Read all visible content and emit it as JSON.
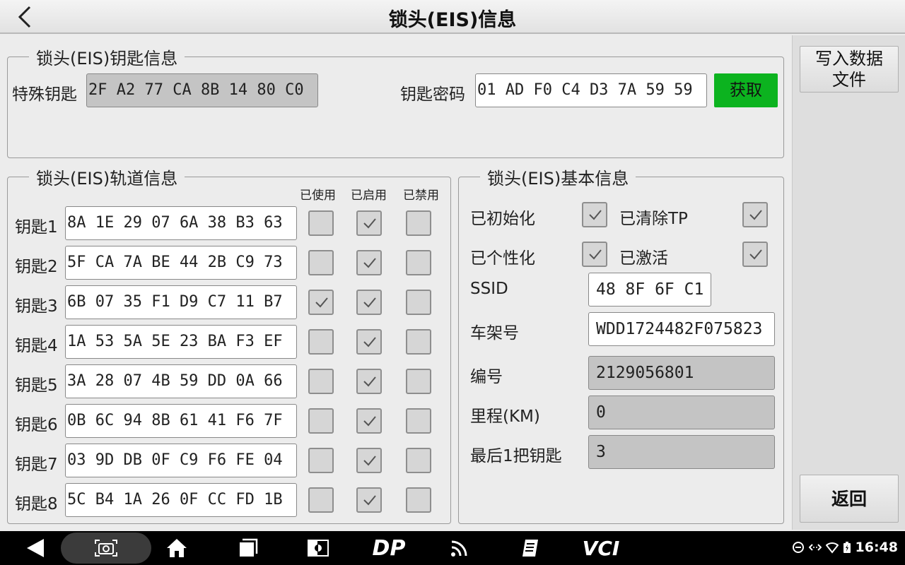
{
  "header": {
    "title": "锁头(EIS)信息"
  },
  "key_info": {
    "title": "锁头(EIS)钥匙信息",
    "special_key_label": "特殊钥匙",
    "special_key_value": "2F A2 77 CA 8B 14 80 C0",
    "key_password_label": "钥匙密码",
    "key_password_value": "01 AD F0 C4 D3 7A 59 59",
    "get_button": "获取"
  },
  "track_info": {
    "title": "锁头(EIS)轨道信息",
    "columns": [
      "已使用",
      "已启用",
      "已禁用"
    ],
    "keys": [
      {
        "label": "钥匙1",
        "value": "8A 1E 29 07 6A 38 B3 63",
        "used": false,
        "enabled": true,
        "disabled": false
      },
      {
        "label": "钥匙2",
        "value": "5F CA 7A BE 44 2B C9 73",
        "used": false,
        "enabled": true,
        "disabled": false
      },
      {
        "label": "钥匙3",
        "value": "6B 07 35 F1 D9 C7 11 B7",
        "used": true,
        "enabled": true,
        "disabled": false
      },
      {
        "label": "钥匙4",
        "value": "1A 53 5A 5E 23 BA F3 EF",
        "used": false,
        "enabled": true,
        "disabled": false
      },
      {
        "label": "钥匙5",
        "value": "3A 28 07 4B 59 DD 0A 66",
        "used": false,
        "enabled": true,
        "disabled": false
      },
      {
        "label": "钥匙6",
        "value": "0B 6C 94 8B 61 41 F6 7F",
        "used": false,
        "enabled": true,
        "disabled": false
      },
      {
        "label": "钥匙7",
        "value": "03 9D DB 0F C9 F6 FE 04",
        "used": false,
        "enabled": true,
        "disabled": false
      },
      {
        "label": "钥匙8",
        "value": "5C B4 1A 26 0F CC FD 1B",
        "used": false,
        "enabled": true,
        "disabled": false
      }
    ]
  },
  "basic_info": {
    "title": "锁头(EIS)基本信息",
    "initialized_label": "已初始化",
    "initialized": true,
    "tp_cleared_label": "已清除TP",
    "tp_cleared": true,
    "personalized_label": "已个性化",
    "personalized": true,
    "activated_label": "已激活",
    "activated": true,
    "ssid_label": "SSID",
    "ssid_value": "48 8F 6F C1",
    "vin_label": "车架号",
    "vin_value": "WDD1724482F075823",
    "number_label": "编号",
    "number_value": "2129056801",
    "mileage_label": "里程(KM)",
    "mileage_value": "0",
    "last_key_label": "最后1把钥匙",
    "last_key_value": "3"
  },
  "side": {
    "write_file_button": "写入数据\n文件",
    "return_button": "返回"
  },
  "navbar": {
    "icons": [
      "back-icon",
      "screenshot-icon",
      "home-icon",
      "recent-apps-icon",
      "brightness-icon",
      "dp-icon",
      "wifi-signal-icon",
      "notes-icon",
      "vci-icon"
    ],
    "vci_label": "VCI",
    "dp_label": "DP",
    "time": "16:48"
  },
  "colors": {
    "accent_green": "#0cb31f",
    "field_grey": "#c4c4c4",
    "navbar": "#000000"
  }
}
